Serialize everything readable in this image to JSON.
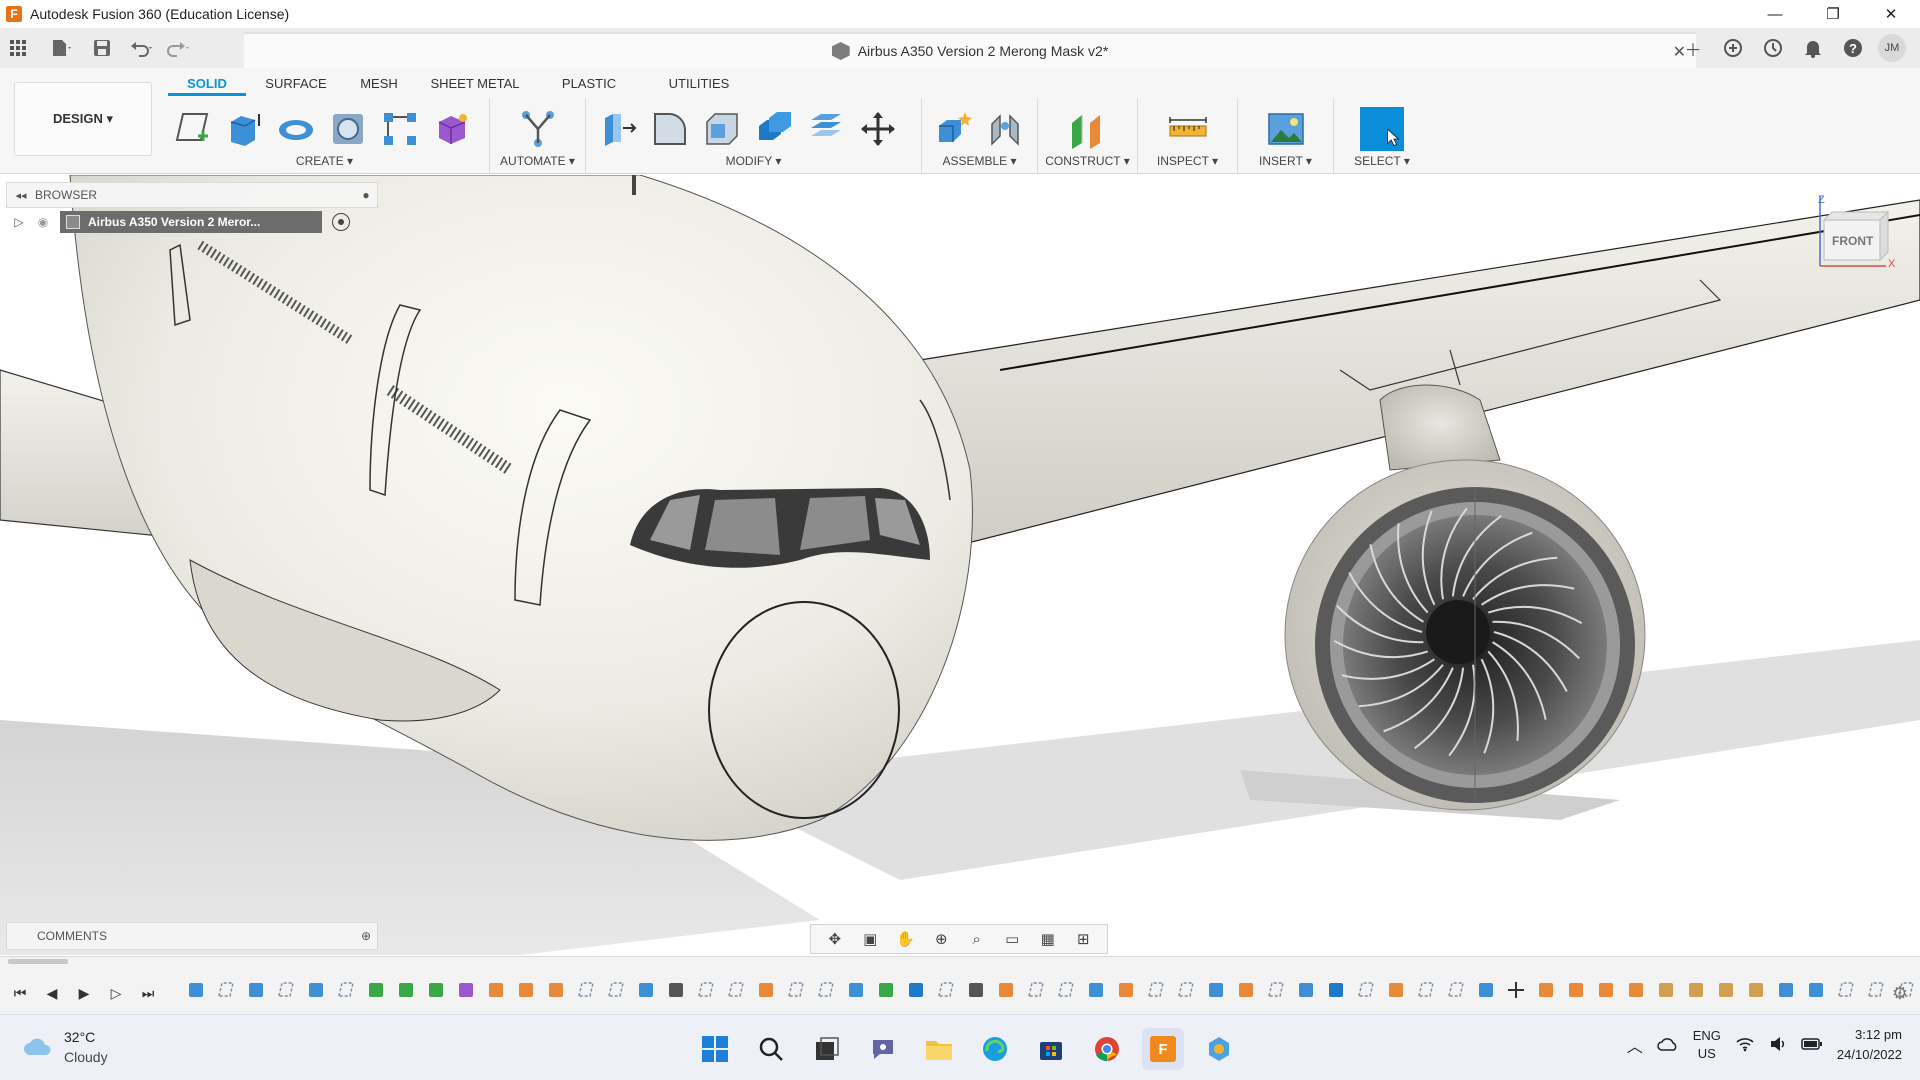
{
  "window": {
    "app_title": "Autodesk Fusion 360 (Education License)",
    "minimize": "—",
    "maximize": "❐",
    "close": "✕"
  },
  "document": {
    "tab_title": "Airbus A350 Version 2 Merong Mask v2*"
  },
  "user": {
    "initials": "JM"
  },
  "ribbon": {
    "workspace": "DESIGN ▾",
    "tabs": [
      "SOLID",
      "SURFACE",
      "MESH",
      "SHEET METAL",
      "PLASTIC",
      "UTILITIES"
    ],
    "active_tab": "SOLID",
    "groups": {
      "create": "CREATE ▾",
      "automate": "AUTOMATE ▾",
      "modify": "MODIFY ▾",
      "assemble": "ASSEMBLE ▾",
      "construct": "CONSTRUCT ▾",
      "inspect": "INSPECT ▾",
      "insert": "INSERT ▾",
      "select": "SELECT ▾"
    }
  },
  "browser": {
    "title": "BROWSER",
    "root_node": "Airbus A350 Version 2 Meror..."
  },
  "comments": {
    "title": "COMMENTS"
  },
  "viewcube": {
    "face": "FRONT",
    "z_label": "Z",
    "x_label": "X"
  },
  "colors": {
    "accent": "#0696d7",
    "select_blue": "#0a8ed9",
    "plane_body": "#ecebe3",
    "engine_dark": "#3b3b3b"
  },
  "taskbar": {
    "weather_temp": "32°C",
    "weather_desc": "Cloudy",
    "lang_top": "ENG",
    "lang_bottom": "US",
    "time": "3:12 pm",
    "date": "24/10/2022"
  }
}
